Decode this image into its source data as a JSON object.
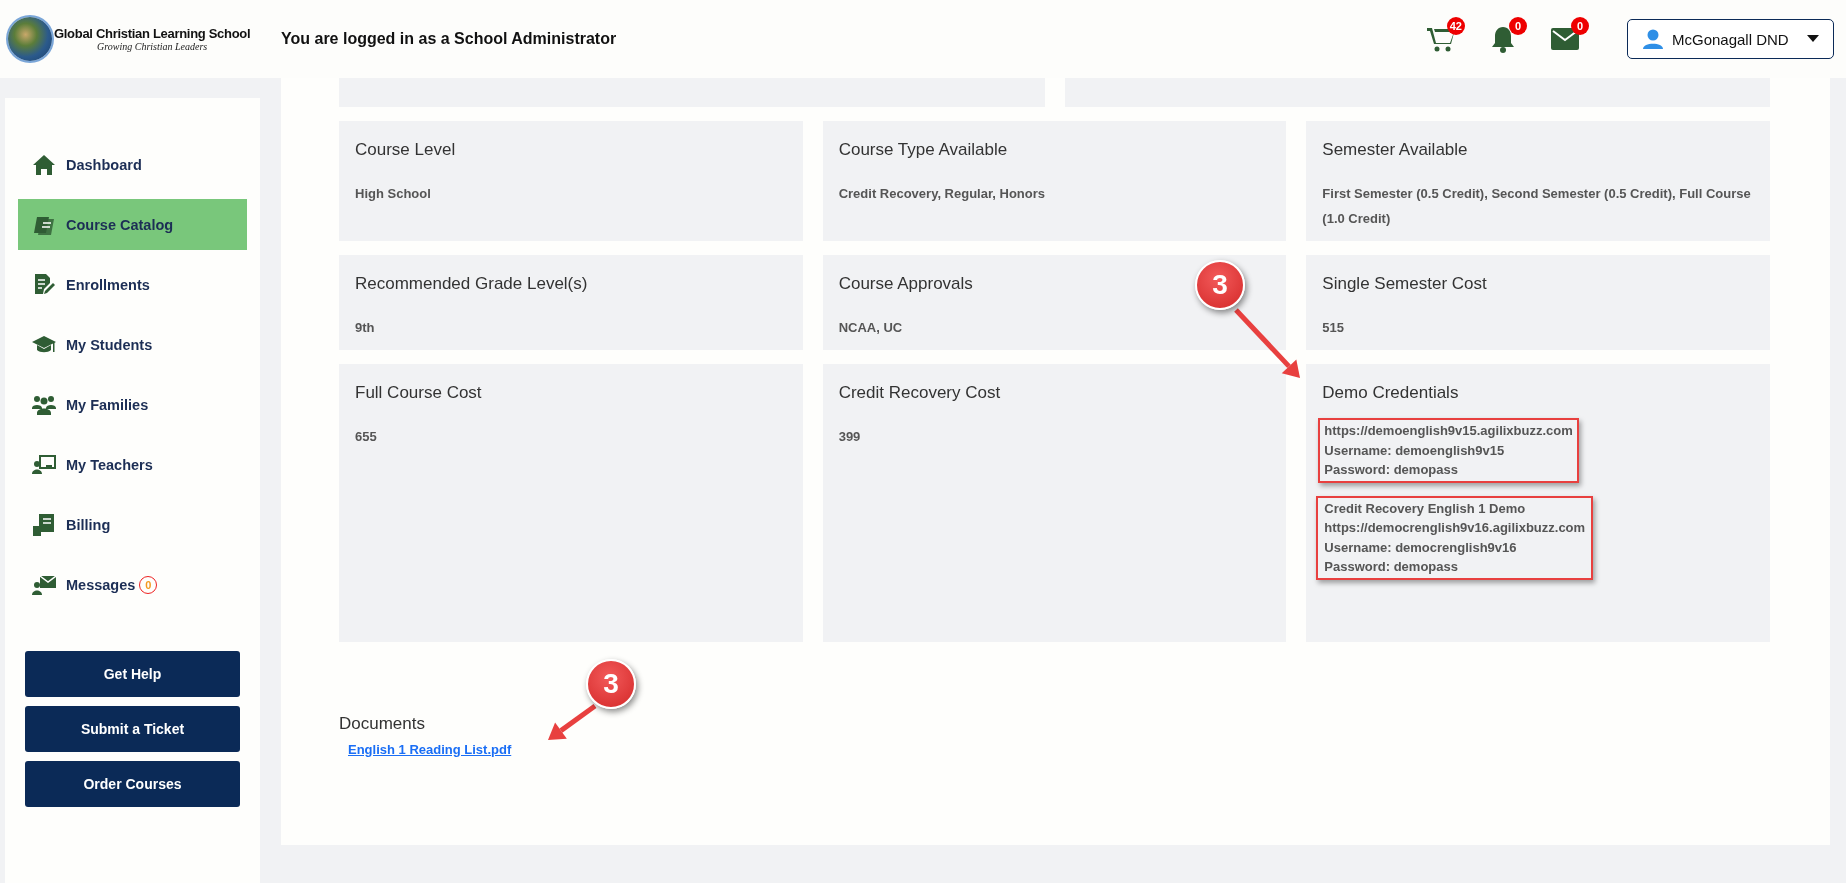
{
  "header": {
    "logo": {
      "name": "Global Christian Learning School",
      "tagline": "Growing Christian Leaders"
    },
    "login_notice": "You are logged in as a School Administrator",
    "icons": [
      {
        "kind": "cart",
        "badge": "42"
      },
      {
        "kind": "bell",
        "badge": "0"
      },
      {
        "kind": "mail",
        "badge": "0"
      }
    ],
    "user_menu": {
      "label": "McGonagall DND"
    }
  },
  "sidebar": {
    "items": [
      {
        "kind": "home",
        "label": "Dashboard",
        "selected": false
      },
      {
        "kind": "catalog",
        "label": "Course Catalog",
        "selected": true
      },
      {
        "kind": "enroll",
        "label": "Enrollments",
        "selected": false
      },
      {
        "kind": "students",
        "label": "My Students",
        "selected": false
      },
      {
        "kind": "families",
        "label": "My Families",
        "selected": false
      },
      {
        "kind": "teachers",
        "label": "My Teachers",
        "selected": false
      },
      {
        "kind": "billing",
        "label": "Billing",
        "selected": false
      },
      {
        "kind": "messages",
        "label": "Messages",
        "selected": false,
        "badge": "0"
      }
    ],
    "buttons": [
      "Get Help",
      "Submit a Ticket",
      "Order Courses"
    ]
  },
  "cards": [
    {
      "title": "Course Level",
      "value": "High School"
    },
    {
      "title": "Course Type Available",
      "value": "Credit Recovery, Regular, Honors"
    },
    {
      "title": "Semester Available",
      "value": "First Semester (0.5 Credit), Second Semester (0.5 Credit), Full Course (1.0 Credit)"
    },
    {
      "title": "Recommended Grade Level(s)",
      "value": "9th"
    },
    {
      "title": "Course Approvals",
      "value": "NCAA, UC"
    },
    {
      "title": "Single Semester Cost",
      "value": "515"
    },
    {
      "title": "Full Course Cost",
      "value": "655"
    },
    {
      "title": "Credit Recovery Cost",
      "value": "399"
    },
    {
      "title": "Demo Credentials",
      "credential_blocks": [
        [
          "https://demoenglish9v15.agilixbuzz.com",
          "Username: demoenglish9v15",
          "Password: demopass"
        ],
        [
          "Credit Recovery English 1 Demo",
          "https://democrenglish9v16.agilixbuzz.com",
          "Username: democrenglish9v16",
          "Password: demopass"
        ]
      ]
    }
  ],
  "documents": {
    "title": "Documents",
    "links": [
      "English 1 Reading List.pdf"
    ]
  },
  "annotations": [
    {
      "label": "3"
    },
    {
      "label": "3"
    }
  ]
}
